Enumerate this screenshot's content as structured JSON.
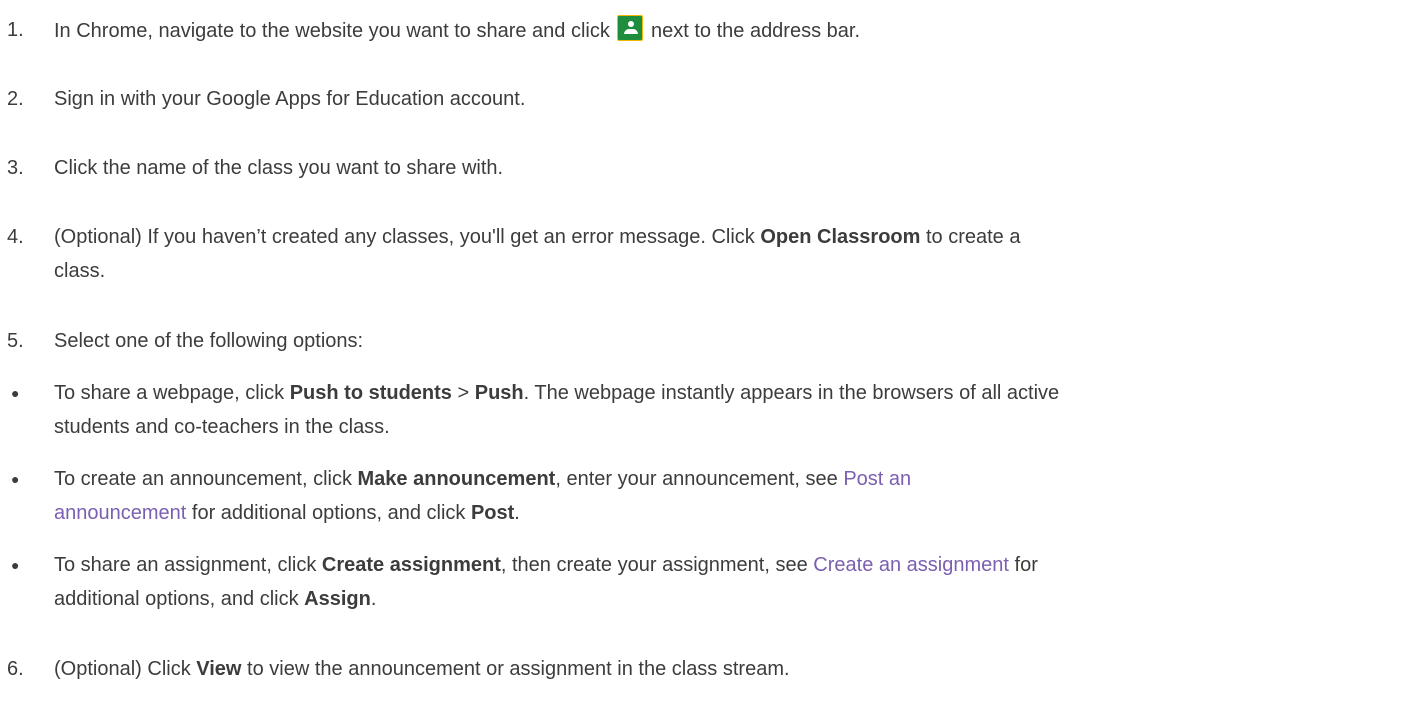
{
  "steps": {
    "s1": {
      "num": "1.",
      "a": "In Chrome, navigate to the website you want to share and click",
      "b": "next to the address bar."
    },
    "s2": {
      "num": "2.",
      "text": "Sign in with your Google Apps for Education account."
    },
    "s3": {
      "num": "3.",
      "text": "Click the name of the class you want to share with."
    },
    "s4": {
      "num": "4.",
      "a": "(Optional) If you haven’t created any classes, you'll get an error message. Click",
      "bold": "Open Classroom",
      "b": "to create a",
      "c": "class."
    },
    "s5": {
      "num": "5.",
      "text": "Select one of the following options:"
    },
    "s6": {
      "num": "6.",
      "a": "(Optional) Click",
      "bold": "View",
      "b": "to view the announcement or assignment in the class stream."
    }
  },
  "options": {
    "o1": {
      "a": "To share a webpage, click",
      "bold1": "Push to students",
      "sep": ">",
      "bold2": "Push",
      "b": ". The webpage instantly appears in the browsers of all active",
      "c": "students and co-teachers in the class."
    },
    "o2": {
      "a": "To create an announcement, click",
      "bold1": "Make announcement",
      "b": ", enter your announcement, see",
      "link1": "Post an",
      "link2": "announcement",
      "c": "for additional options, and click",
      "bold2": "Post",
      "d": "."
    },
    "o3": {
      "a": "To share an assignment, click",
      "bold1": "Create assignment",
      "b": ", then create your assignment, see",
      "link": "Create an assignment",
      "c": "for",
      "d": "additional options, and click",
      "bold2": "Assign",
      "e": "."
    }
  },
  "bullet_char": "●",
  "icon": {
    "name": "google-classroom-icon",
    "colors": {
      "bg": "#1e8e3e",
      "border": "#f2b705"
    }
  },
  "colors": {
    "text": "#3c3c3c",
    "link": "#7b5fb0"
  }
}
